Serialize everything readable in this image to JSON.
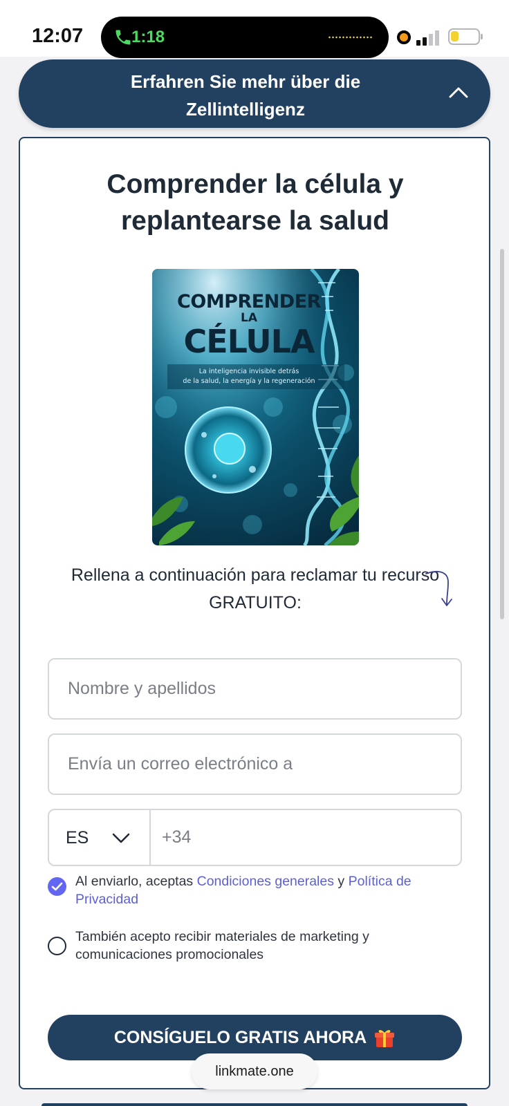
{
  "status_bar": {
    "time": "12:07",
    "call_duration": "1:18",
    "battery_level": 0.3
  },
  "accordion": {
    "title": "Erfahren Sie mehr über die Zellintelligenz"
  },
  "card": {
    "title": "Comprender la célula y replantearse la salud",
    "cover": {
      "line1": "COMPRENDER",
      "line2": "LA",
      "line3": "CÉLULA",
      "subtitle_line1": "La inteligencia invisible detrás",
      "subtitle_line2": "de la salud, la energía y la regeneración"
    },
    "lead": "Rellena a continuación para reclamar tu recurso GRATUITO:"
  },
  "form": {
    "name_placeholder": "Nombre y apellidos",
    "name_value": "",
    "email_placeholder": "Envía un correo electrónico a",
    "email_value": "",
    "country_code": "ES",
    "phone_placeholder": "+34",
    "phone_value": "",
    "consent_terms": {
      "checked": true,
      "prefix": "Al enviarlo, aceptas ",
      "terms_link": "Condiciones generales",
      "joiner": " y ",
      "privacy_link": "Política de Privacidad"
    },
    "consent_marketing": {
      "checked": false,
      "text": "También acepto recibir materiales de marketing y comunicaciones promocionales"
    },
    "submit_label": "CONSÍGUELO GRATIS AHORA"
  },
  "footer": {
    "domain": "linkmate.one"
  },
  "colors": {
    "brand": "#22405f",
    "accent": "#6366f1"
  }
}
